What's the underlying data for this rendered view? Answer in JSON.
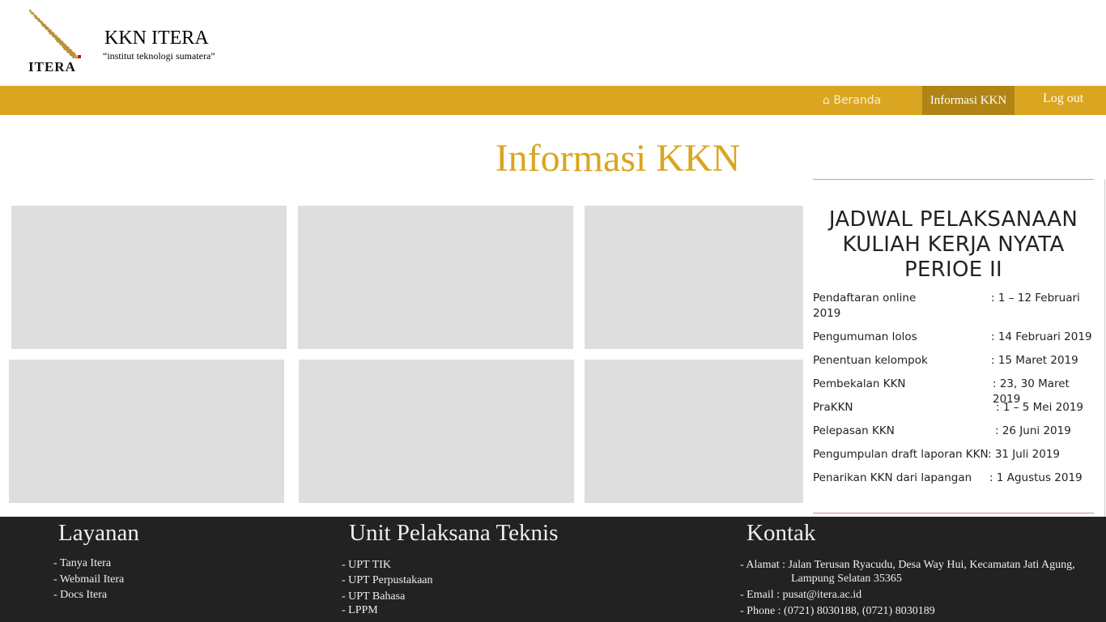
{
  "header": {
    "logo_text": "ITERA",
    "title": "KKN ITERA",
    "subtitle": "“institut teknologi sumatera”"
  },
  "nav": {
    "home": "Beranda",
    "info": "Informasi KKN",
    "logout": "Log out",
    "accent": "#daa520",
    "active_bg": "#b08515"
  },
  "page": {
    "title": "Informasi KKN"
  },
  "schedule": {
    "title_lines": [
      "JADWAL PELAKSANAAN",
      "KULIAH KERJA NYATA",
      "PERIOE II"
    ],
    "rows": [
      {
        "label": "Pendaftaran online",
        "value": ": 1 – 12 Februari",
        "wrap": "2019"
      },
      {
        "label": "Pengumuman lolos",
        "value": ": 14 Februari 2019"
      },
      {
        "label": "Penentuan kelompok",
        "value": ": 15 Maret 2019"
      },
      {
        "label": "Pembekalan KKN",
        "value": ": 23, 30 Maret 2019"
      },
      {
        "label": "PraKKN",
        "value": ": 1 – 5 Mei 2019"
      },
      {
        "label": "Pelepasan KKN",
        "value": ": 26 Juni 2019"
      },
      {
        "label": "Pengumpulan draft laporan KKN",
        "value": ": 31 Juli 2019"
      },
      {
        "label": "Penarikan KKN dari lapangan",
        "value": ": 1 Agustus 2019"
      }
    ]
  },
  "footer": {
    "layanan": {
      "title": "Layanan",
      "items": [
        "- Tanya Itera",
        "- Webmail Itera",
        "- Docs Itera"
      ]
    },
    "upt": {
      "title": "Unit Pelaksana Teknis",
      "items": [
        "- UPT TIK",
        "- UPT Perpustakaan",
        "- UPT Bahasa",
        "- LPPM"
      ]
    },
    "kontak": {
      "title": "Kontak",
      "alamat": "- Alamat : Jalan Terusan Ryacudu, Desa Way Hui, Kecamatan Jati Agung,",
      "alamat2": "Lampung Selatan 35365",
      "email": "- Email : pusat@itera.ac.id",
      "phone": "- Phone : (0721) 8030188, (0721) 8030189"
    }
  }
}
